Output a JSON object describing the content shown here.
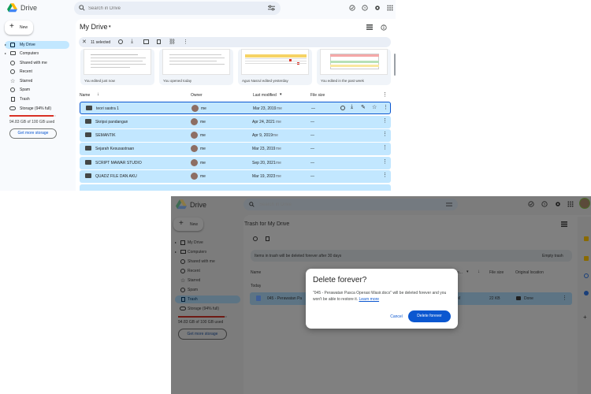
{
  "window1": {
    "app_name": "Drive",
    "search": {
      "placeholder": "Search in Drive"
    },
    "new_button": "New",
    "nav": [
      {
        "label": "My Drive",
        "icon": "my-drive-icon"
      },
      {
        "label": "Computers",
        "icon": "computers-icon"
      },
      {
        "label": "Shared with me",
        "icon": "shared-icon"
      },
      {
        "label": "Recent",
        "icon": "clock-icon"
      },
      {
        "label": "Starred",
        "icon": "star-icon"
      },
      {
        "label": "Spam",
        "icon": "spam-icon"
      },
      {
        "label": "Trash",
        "icon": "trash-icon"
      },
      {
        "label": "Storage (94% full)",
        "icon": "cloud-icon"
      }
    ],
    "storage": {
      "used_text": "94.83 GB of 100 GB used",
      "fraction": 0.9483,
      "button": "Get more storage"
    },
    "page_title": "My Drive",
    "selection": {
      "count_label": "11 selected"
    },
    "suggested": [
      {
        "caption": "You edited just now"
      },
      {
        "caption": "You opened today"
      },
      {
        "caption": "Agus Nasrul edited yesterday"
      },
      {
        "caption": "You edited in the past week"
      }
    ],
    "columns": {
      "name": "Name",
      "owner": "Owner",
      "modified": "Last modified",
      "size": "File size"
    },
    "rows": [
      {
        "name": "teori sastra 1",
        "owner": "me",
        "modified": "Mar 23, 2019",
        "modified_by": "me",
        "size": "—",
        "icon": "folder-icon"
      },
      {
        "name": "Skripsi pandangan",
        "owner": "me",
        "modified": "Apr 24, 2021",
        "modified_by": "me",
        "size": "—",
        "icon": "folder-icon"
      },
      {
        "name": "SEMANTIK",
        "owner": "me",
        "modified": "Apr 9, 2019",
        "modified_by": "me",
        "size": "—",
        "icon": "shared-folder-icon"
      },
      {
        "name": "Sejarah Kesusastraan",
        "owner": "me",
        "modified": "Mar 23, 2019",
        "modified_by": "me",
        "size": "—",
        "icon": "folder-icon"
      },
      {
        "name": "SCRIPT MAWAR STUDIO",
        "owner": "me",
        "modified": "Sep 20, 2021",
        "modified_by": "me",
        "size": "—",
        "icon": "shared-folder-icon"
      },
      {
        "name": "QUADZ FILE DAN AKU",
        "owner": "me",
        "modified": "Mar 19, 2023",
        "modified_by": "me",
        "size": "—",
        "icon": "shared-folder-icon"
      }
    ]
  },
  "window2": {
    "app_name": "Drive",
    "search": {
      "placeholder": "Search in Drive"
    },
    "new_button": "New",
    "nav": [
      {
        "label": "My Drive",
        "icon": "my-drive-icon"
      },
      {
        "label": "Computers",
        "icon": "computers-icon"
      },
      {
        "label": "Shared with me",
        "icon": "shared-icon"
      },
      {
        "label": "Recent",
        "icon": "clock-icon"
      },
      {
        "label": "Starred",
        "icon": "star-icon"
      },
      {
        "label": "Spam",
        "icon": "spam-icon"
      },
      {
        "label": "Trash",
        "icon": "trash-icon"
      },
      {
        "label": "Storage (94% full)",
        "icon": "cloud-icon"
      }
    ],
    "storage": {
      "used_text": "94.83 GB of 100 GB used",
      "fraction": 0.9483,
      "button": "Get more storage"
    },
    "page_title": "Trash for My Drive",
    "banner": {
      "text": "Items in trash will be deleted forever after 30 days",
      "action": "Empty trash"
    },
    "columns": {
      "name": "Name",
      "modified_partial": "e...",
      "size": "File size",
      "location": "Original location"
    },
    "group_label": "Today",
    "file": {
      "name": "045 - Perawatan Pa",
      "modified_partial": "M",
      "size": "22 KB",
      "location": "Done"
    }
  },
  "dialog": {
    "title": "Delete forever?",
    "body": "\"045 - Perawatan Pasca Operasi Wasir.docx\" will be deleted forever and you won't be able to restore it.",
    "link": "Learn more",
    "cancel": "Cancel",
    "confirm": "Delete forever"
  },
  "colors": {
    "accent": "#0b57d0",
    "selection": "#c2e7ff",
    "storage_bar": "#d93025"
  }
}
